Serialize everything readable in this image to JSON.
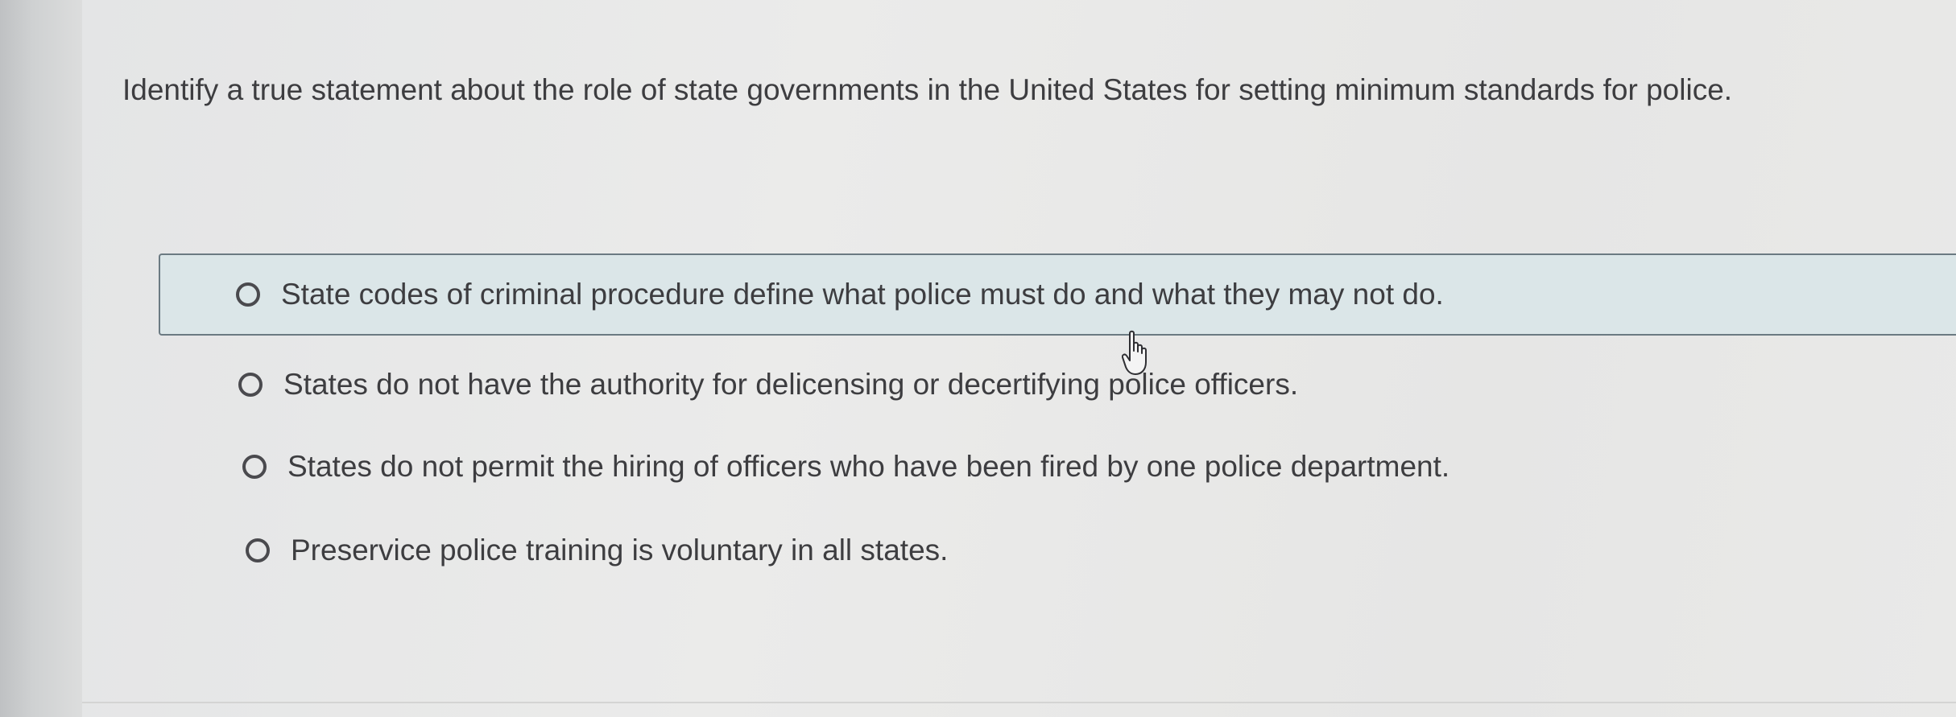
{
  "question": {
    "text": "Identify a true statement about the role of state governments in the United States for setting minimum standards for police."
  },
  "options": [
    {
      "label": "State codes of criminal procedure define what police must do and what they may not do.",
      "highlighted": true
    },
    {
      "label": "States do not have the authority for delicensing or decertifying police officers.",
      "highlighted": false
    },
    {
      "label": "States do not permit the hiring of officers who have been fired by one police department.",
      "highlighted": false
    },
    {
      "label": "Preservice police training is voluntary in all states.",
      "highlighted": false
    }
  ],
  "icons": {
    "radio": "radio-button-icon",
    "cursor": "hand-pointer-cursor-icon"
  },
  "colors": {
    "highlight_background": "#dbe6e8",
    "highlight_border": "#6b7a82",
    "text": "#3d3d40"
  }
}
